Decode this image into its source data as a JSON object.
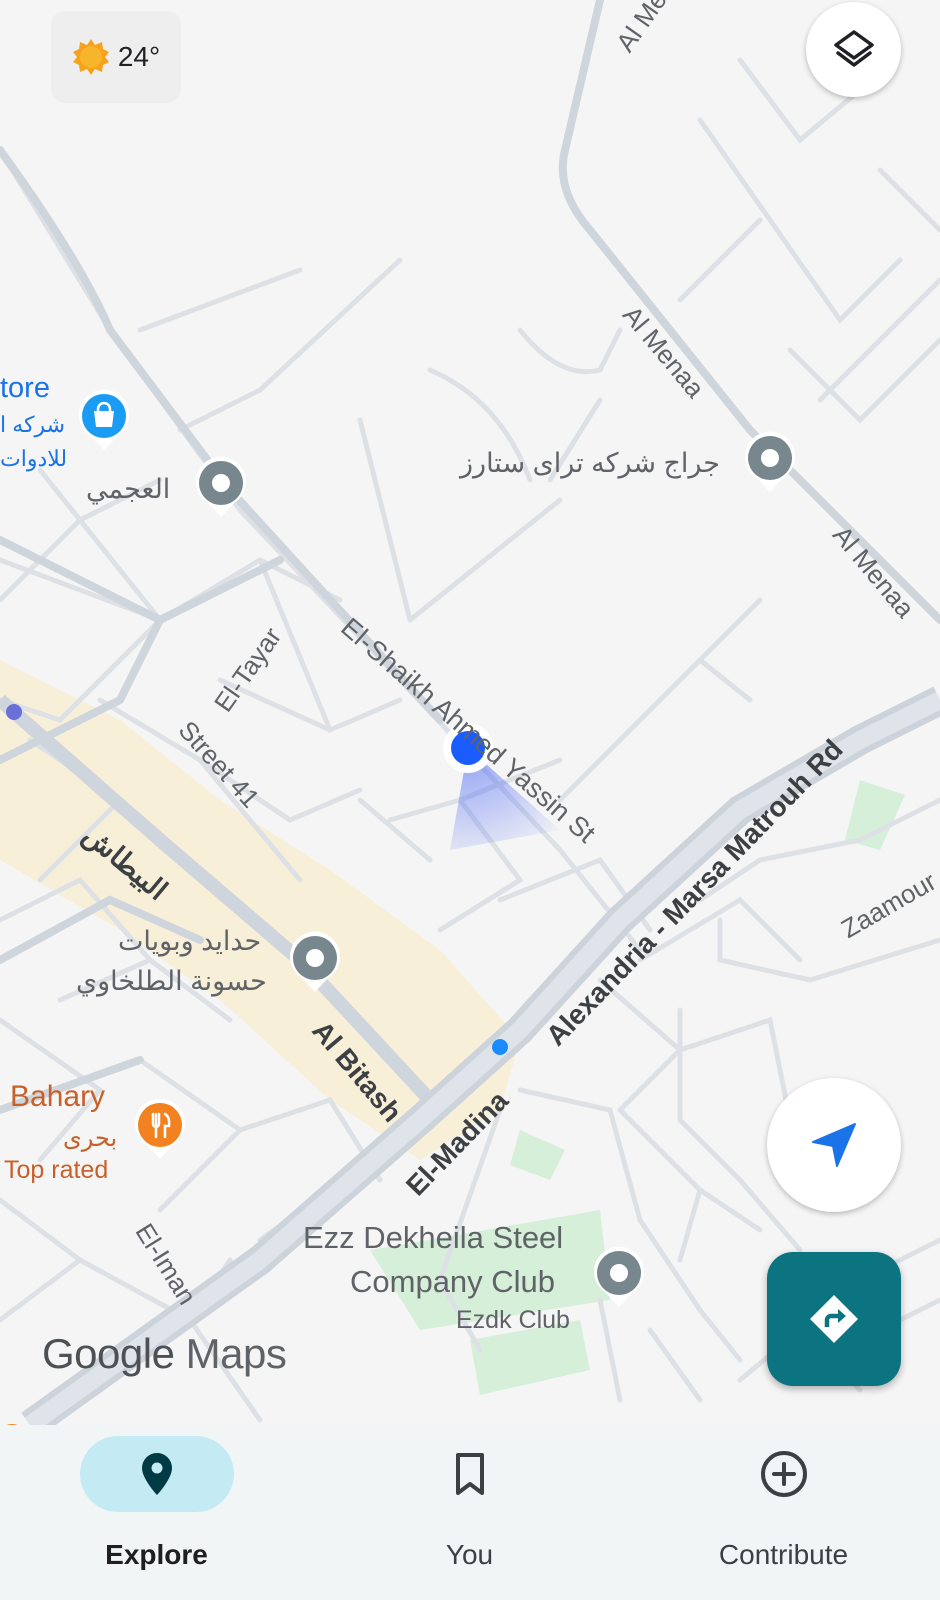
{
  "weather": {
    "icon": "sun-icon",
    "temperature": "24°"
  },
  "map": {
    "roads": {
      "al_menaa_top": "Al Menaa",
      "al_menaa_mid": "Al Menaa",
      "al_menaa_right": "Al Menaa",
      "shaikh_ahmed": "El-Shaikh Ahmed Yassin St",
      "alexandria_marsa": "Alexandria - Marsa Matrouh Rd",
      "el_madina": "El-Madina",
      "el_tayar": "El-Tayar",
      "street_41": "Street 41",
      "al_bitash_ar": "البيطاش",
      "al_bitash": "Al Bitash",
      "zaamour": "Zaamour",
      "el_iman": "El-Iman"
    },
    "places": {
      "store_line1": "tore",
      "store_line2": "شركه ا",
      "store_line3": "للادوات",
      "alagamy": "العجمي",
      "garage": "جراج شركه تراى ستارز",
      "hadayed_line1": "حدايد وبويات",
      "hadayed_line2": "حسونة الطلخاوي",
      "bahary": "Bahary",
      "bahary_ar": "بحرى",
      "bahary_badge": "Top rated",
      "ezz_line1": "Ezz Dekheila Steel",
      "ezz_line2": "Company Club",
      "ezz_sub": "Ezdk Club"
    },
    "colors": {
      "user_location": "#1a5cff",
      "restaurant": "#f2821f",
      "shopping": "#1a9cf4",
      "poi": "#78868e"
    }
  },
  "brand": {
    "google": "Google",
    "maps": "Maps"
  },
  "controls": {
    "layers": "layers-icon",
    "my_location": "navigation-arrow-icon",
    "directions": "directions-icon"
  },
  "nav": [
    {
      "label": "Explore",
      "icon": "location-pin-icon",
      "active": true
    },
    {
      "label": "You",
      "icon": "bookmark-icon",
      "active": false
    },
    {
      "label": "Contribute",
      "icon": "add-circle-icon",
      "active": false
    }
  ]
}
